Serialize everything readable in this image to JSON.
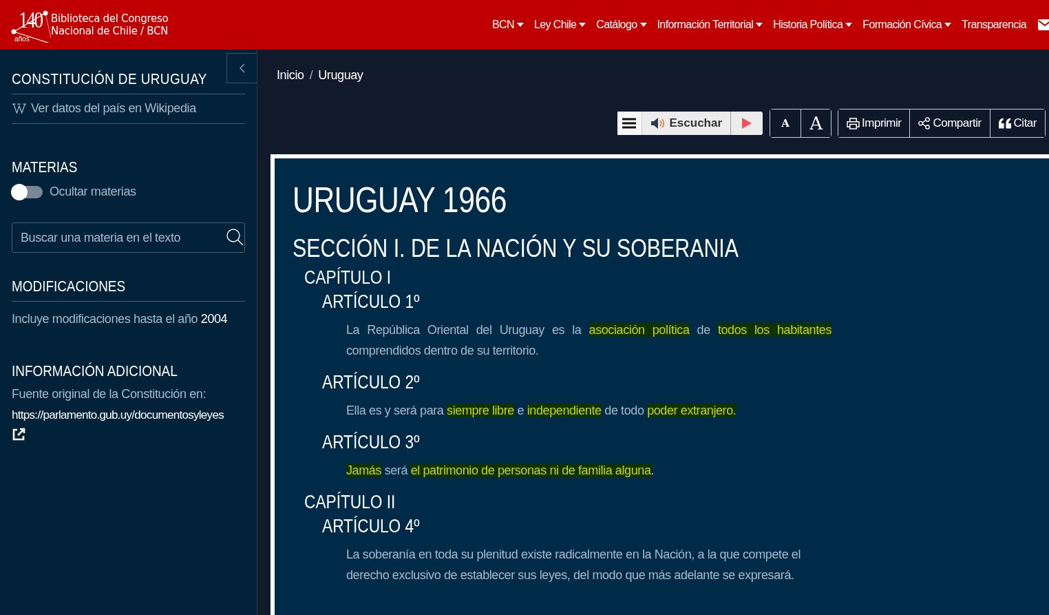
{
  "header": {
    "logo_number": "140",
    "logo_sub": "años",
    "logo_line1": "Biblioteca del Congreso",
    "logo_line2": "Nacional de Chile / BCN",
    "nav": [
      {
        "label": "BCN",
        "has_menu": true
      },
      {
        "label": "Ley Chile",
        "has_menu": true
      },
      {
        "label": "Catálogo",
        "has_menu": true
      },
      {
        "label": "Información Territorial",
        "has_menu": true
      },
      {
        "label": "Historia Política",
        "has_menu": true
      },
      {
        "label": "Formación Cívica",
        "has_menu": true
      },
      {
        "label": "Transparencia",
        "has_menu": false
      }
    ]
  },
  "sidebar": {
    "title": "CONSTITUCIÓN DE URUGUAY",
    "wiki_link": "Ver datos del país en Wikipedia",
    "materias": {
      "heading": "MATERIAS",
      "toggle_label": "Ocultar materias",
      "on": false,
      "search_placeholder": "Buscar una materia en el texto"
    },
    "modificaciones": {
      "heading": "MODIFICACIONES",
      "text": "Incluye modificaciones hasta el año **2004**"
    },
    "info": {
      "heading": "INFORMACIÓN ADICIONAL",
      "text": "Fuente original de la Constitución en:",
      "url": "https://parlamento.gub.uy/documentosyleyes"
    }
  },
  "breadcrumb": {
    "separator": "/",
    "items": [
      {
        "label": "Inicio"
      },
      {
        "label": "Uruguay"
      }
    ]
  },
  "toolbar": {
    "listen": "Escuchar",
    "font_small": "A",
    "font_large": "A",
    "actions": [
      {
        "label": "Imprimir",
        "kind": "print"
      },
      {
        "label": "Compartir",
        "kind": "share"
      },
      {
        "label": "Citar",
        "kind": "cite"
      }
    ]
  },
  "document": {
    "title": "URUGUAY 1966",
    "section": "SECCIÓN I. DE LA NACIÓN Y SU SOBERANIA",
    "chapters": [
      {
        "title": "CAPÍTULO I",
        "articles": [
          {
            "title": "ARTÍCULO 1º",
            "justify": true,
            "segments": [
              {
                "text": "La República Oriental del Uruguay es la ",
                "highlighted": false
              },
              {
                "text": "asociación política",
                "highlighted": true
              },
              {
                "text": " de ",
                "highlighted": false
              },
              {
                "text": "todos los habitantes",
                "highlighted": true
              },
              {
                "text": " comprendidos dentro de su territorio.",
                "highlighted": false
              }
            ]
          },
          {
            "title": "ARTÍCULO 2º",
            "justify": false,
            "segments": [
              {
                "text": "Ella es y será para ",
                "highlighted": false
              },
              {
                "text": "siempre libre",
                "highlighted": true
              },
              {
                "text": " e ",
                "highlighted": false
              },
              {
                "text": "independiente",
                "highlighted": true
              },
              {
                "text": " de todo ",
                "highlighted": false
              },
              {
                "text": "poder extranjero.",
                "highlighted": true
              }
            ]
          },
          {
            "title": "ARTÍCULO 3º",
            "justify": false,
            "segments": [
              {
                "text": "Jamás",
                "highlighted": true
              },
              {
                "text": " será ",
                "highlighted": false
              },
              {
                "text": "el patrimonio de personas ",
                "highlighted": true
              },
              {
                "text": "ni de familia alguna",
                "highlighted": true
              },
              {
                "text": ".",
                "highlighted": false
              }
            ]
          }
        ]
      },
      {
        "title": "CAPÍTULO II",
        "articles": [
          {
            "title": "ARTÍCULO 4º",
            "justify": false,
            "segments": [
              {
                "text": "La soberanía en toda su plenitud existe radicalmente en la Nación, a la que compete el derecho exclusivo de establecer sus leyes, del modo que más adelante se expresará.",
                "highlighted": false
              }
            ]
          }
        ]
      }
    ]
  }
}
